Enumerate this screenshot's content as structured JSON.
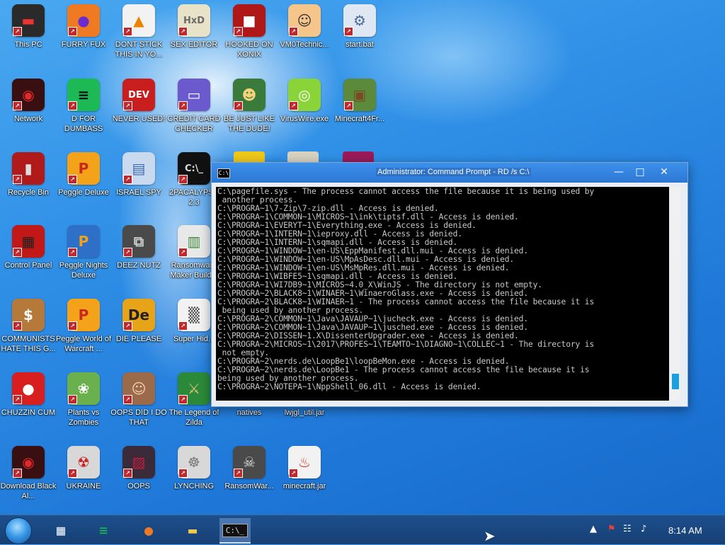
{
  "desktop": {
    "icons": [
      {
        "label": "This PC",
        "glyph": "▬",
        "bg": "#2a2a2a",
        "color": "#e33"
      },
      {
        "label": "FURRY FUX",
        "glyph": "●",
        "bg": "#f07a22",
        "color": "#6b2bd0"
      },
      {
        "label": "DONT STICK THIS IN YO...",
        "glyph": "▲",
        "bg": "#f2f2f2",
        "color": "#f08000"
      },
      {
        "label": "SEX EDITOR",
        "glyph": "HxD",
        "bg": "#e8e2c8",
        "color": "#6b6b6b"
      },
      {
        "label": "HOOKED ON XONIX",
        "glyph": "■",
        "bg": "#b01818",
        "color": "#fff"
      },
      {
        "label": "VM0Technic...",
        "glyph": "☺",
        "bg": "#f5c58a",
        "color": "#333"
      },
      {
        "label": "start.bat",
        "glyph": "⚙",
        "bg": "#dfe7f2",
        "color": "#4a6a9a"
      },
      {
        "label": "Network",
        "glyph": "◉",
        "bg": "#3a0f12",
        "color": "#e02a2a"
      },
      {
        "label": "D FOR DUMBASS",
        "glyph": "≡",
        "bg": "#1db954",
        "color": "#111"
      },
      {
        "label": "NEVER USED!",
        "glyph": "DEV",
        "bg": "#c81e1e",
        "color": "#fff"
      },
      {
        "label": "CREDIT CARD CHECKER",
        "glyph": "▭",
        "bg": "#6a5acd",
        "color": "#fff"
      },
      {
        "label": "BE JUST LIKE THE DUDE!",
        "glyph": "☻",
        "bg": "#3a7a3a",
        "color": "#f2d27a"
      },
      {
        "label": "VirusWire.exe",
        "glyph": "◎",
        "bg": "#8ad43a",
        "color": "#fff"
      },
      {
        "label": "Minecraft4Fr...",
        "glyph": "▣",
        "bg": "#5b8a3a",
        "color": "#7a4a22"
      },
      {
        "label": "Recycle Bin",
        "glyph": "▮",
        "bg": "#b01a1a",
        "color": "#ddd"
      },
      {
        "label": "Peggle Deluxe",
        "glyph": "P",
        "bg": "#f3a21a",
        "color": "#c8281e"
      },
      {
        "label": "ISRAEL SPY",
        "glyph": "▤",
        "bg": "#c9d9ee",
        "color": "#3a6ab0"
      },
      {
        "label": "2PACALYPSE 2.3",
        "glyph": "C:\\_",
        "bg": "#111",
        "color": "#ddd"
      },
      {
        "label": "Control Panel",
        "glyph": "▦",
        "bg": "#c21818",
        "color": "#222"
      },
      {
        "label": "Peggle Nights Deluxe",
        "glyph": "P",
        "bg": "#2e6fc8",
        "color": "#f2a21a"
      },
      {
        "label": "DEEZ NUTZ",
        "glyph": "⧉",
        "bg": "#4a4a4a",
        "color": "#ccc"
      },
      {
        "label": "Ransomware Maker Build...",
        "glyph": "▥",
        "bg": "#e8e8e8",
        "color": "#3a8a3a"
      },
      {
        "label": "COMMUNISTS HATE THIS G...",
        "glyph": "$",
        "bg": "#b57a3a",
        "color": "#fff"
      },
      {
        "label": "Peggle World of Warcraft ...",
        "glyph": "P",
        "bg": "#f3a21a",
        "color": "#c8281e"
      },
      {
        "label": "DIE PLEASE",
        "glyph": "De",
        "bg": "#e8a418",
        "color": "#222"
      },
      {
        "label": "Super Hid...",
        "glyph": "▒",
        "bg": "#f2f2f2",
        "color": "#444"
      },
      {
        "label": "CHUZZIN CUM",
        "glyph": "●",
        "bg": "#d81e1e",
        "color": "#fff"
      },
      {
        "label": "Plants vs Zombies",
        "glyph": "❀",
        "bg": "#6ab04c",
        "color": "#fff"
      },
      {
        "label": "OOPS DID I DO THAT",
        "glyph": "☺",
        "bg": "#9a6a4a",
        "color": "#f2d2b2"
      },
      {
        "label": "The Legend of Zilda",
        "glyph": "⚔",
        "bg": "#2a8a3a",
        "color": "#e8c07a"
      },
      {
        "label": "natives",
        "glyph": "",
        "bg": "transparent",
        "color": "#fff"
      },
      {
        "label": "lwjgl_util.jar",
        "glyph": "",
        "bg": "transparent",
        "color": "#fff"
      },
      {
        "label": "Download Black Al...",
        "glyph": "◉",
        "bg": "#3a0f12",
        "color": "#e02a2a"
      },
      {
        "label": "UKRAINE",
        "glyph": "☢",
        "bg": "#d8d8d8",
        "color": "#c81e1e"
      },
      {
        "label": "OOPS",
        "glyph": "▨",
        "bg": "#3a2a3a",
        "color": "#c81e3a"
      },
      {
        "label": "LYNCHING",
        "glyph": "☸",
        "bg": "#d8d8d8",
        "color": "#7a7a7a"
      },
      {
        "label": "RansomWar...",
        "glyph": "☠",
        "bg": "#4a4a4a",
        "color": "#ddd"
      },
      {
        "label": "minecraft.jar",
        "glyph": "♨",
        "bg": "#f2f2f2",
        "color": "#c8281e"
      }
    ]
  },
  "cmd_window": {
    "title": "Administrator: Command Prompt - RD  /s C:\\",
    "icon_text": "C:\\",
    "min_glyph": "—",
    "max_glyph": "□",
    "close_glyph": "✕",
    "lines": [
      "C:\\pagefile.sys - The process cannot access the file because it is being used by",
      " another process.",
      "C:\\PROGRA~1\\7-Zip\\7-zip.dll - Access is denied.",
      "C:\\PROGRA~1\\COMMON~1\\MICROS~1\\ink\\tiptsf.dll - Access is denied.",
      "C:\\PROGRA~1\\EVERYT~1\\Everything.exe - Access is denied.",
      "C:\\PROGRA~1\\INTERN~1\\ieproxy.dll - Access is denied.",
      "C:\\PROGRA~1\\INTERN~1\\sqmapi.dll - Access is denied.",
      "C:\\PROGRA~1\\WINDOW~1\\en-US\\EppManifest.dll.mui - Access is denied.",
      "C:\\PROGRA~1\\WINDOW~1\\en-US\\MpAsDesc.dll.mui - Access is denied.",
      "C:\\PROGRA~1\\WINDOW~1\\en-US\\MsMpRes.dll.mui - Access is denied.",
      "C:\\PROGRA~1\\WIBFE5~1\\sqmapi.dll - Access is denied.",
      "C:\\PROGRA~1\\WI7DB9~1\\MICROS~4.0_X\\WinJS - The directory is not empty.",
      "C:\\PROGRA~2\\BLACK8~1\\WINAER~1\\WinaeroGlass.exe - Access is denied.",
      "C:\\PROGRA~2\\BLACK8~1\\WINAER~1 - The process cannot access the file because it is",
      " being used by another process.",
      "C:\\PROGRA~2\\COMMON~1\\Java\\JAVAUP~1\\jucheck.exe - Access is denied.",
      "C:\\PROGRA~2\\COMMON~1\\Java\\JAVAUP~1\\jusched.exe - Access is denied.",
      "C:\\PROGRA~2\\DISSEN~1.X\\DissenterUpgrader.exe - Access is denied.",
      "C:\\PROGRA~2\\MICROS~1\\2017\\PROFES~1\\TEAMTO~1\\DIAGNO~1\\COLLEC~1 - The directory is",
      " not empty.",
      "C:\\PROGRA~2\\nerds.de\\LoopBe1\\loopBeMon.exe - Access is denied.",
      "C:\\PROGRA~2\\nerds.de\\LoopBe1 - The process cannot access the file because it is",
      "being used by another process.",
      "C:\\PROGRA~2\\NOTEPA~1\\NppShell_06.dll - Access is denied."
    ]
  },
  "taskbar": {
    "items": [
      {
        "name": "taskview-icon",
        "glyph": "▦",
        "color": "#dfe8f5"
      },
      {
        "name": "spotify-icon",
        "glyph": "≡",
        "color": "#1db954"
      },
      {
        "name": "firefox-icon",
        "glyph": "●",
        "color": "#f07a22"
      },
      {
        "name": "file-explorer-icon",
        "glyph": "▬",
        "color": "#f2c94c"
      },
      {
        "name": "cmd-icon",
        "glyph": "C:\\_",
        "color": "#ddd"
      }
    ],
    "tray": {
      "chevron": "▲",
      "flag": "⚑",
      "network": "☷",
      "volume": "♪"
    },
    "clock": "8:14 AM"
  }
}
